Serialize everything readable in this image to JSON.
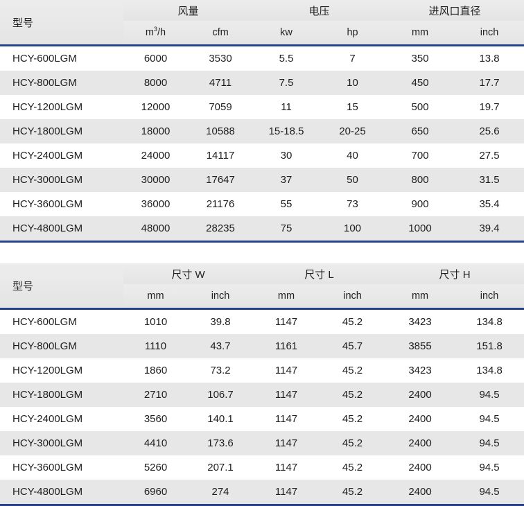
{
  "tables": [
    {
      "id": "performance-table",
      "model_header": "型号",
      "groups": [
        {
          "label": "风量",
          "units": [
            "m³/h",
            "cfm"
          ]
        },
        {
          "label": "电压",
          "units": [
            "kw",
            "hp"
          ]
        },
        {
          "label": "进风口直径",
          "units": [
            "mm",
            "inch"
          ]
        }
      ],
      "rows": [
        {
          "model": "HCY-600LGM",
          "cells": [
            "6000",
            "3530",
            "5.5",
            "7",
            "350",
            "13.8"
          ]
        },
        {
          "model": "HCY-800LGM",
          "cells": [
            "8000",
            "4711",
            "7.5",
            "10",
            "450",
            "17.7"
          ]
        },
        {
          "model": "HCY-1200LGM",
          "cells": [
            "12000",
            "7059",
            "11",
            "15",
            "500",
            "19.7"
          ]
        },
        {
          "model": "HCY-1800LGM",
          "cells": [
            "18000",
            "10588",
            "15-18.5",
            "20-25",
            "650",
            "25.6"
          ]
        },
        {
          "model": "HCY-2400LGM",
          "cells": [
            "24000",
            "14117",
            "30",
            "40",
            "700",
            "27.5"
          ]
        },
        {
          "model": "HCY-3000LGM",
          "cells": [
            "30000",
            "17647",
            "37",
            "50",
            "800",
            "31.5"
          ]
        },
        {
          "model": "HCY-3600LGM",
          "cells": [
            "36000",
            "21176",
            "55",
            "73",
            "900",
            "35.4"
          ]
        },
        {
          "model": "HCY-4800LGM",
          "cells": [
            "48000",
            "28235",
            "75",
            "100",
            "1000",
            "39.4"
          ]
        }
      ]
    },
    {
      "id": "dimensions-table",
      "model_header": "型号",
      "groups": [
        {
          "label": "尺寸 W",
          "units": [
            "mm",
            "inch"
          ]
        },
        {
          "label": "尺寸 L",
          "units": [
            "mm",
            "inch"
          ]
        },
        {
          "label": "尺寸 H",
          "units": [
            "mm",
            "inch"
          ]
        }
      ],
      "rows": [
        {
          "model": "HCY-600LGM",
          "cells": [
            "1010",
            "39.8",
            "1147",
            "45.2",
            "3423",
            "134.8"
          ]
        },
        {
          "model": "HCY-800LGM",
          "cells": [
            "1110",
            "43.7",
            "1161",
            "45.7",
            "3855",
            "151.8"
          ]
        },
        {
          "model": "HCY-1200LGM",
          "cells": [
            "1860",
            "73.2",
            "1147",
            "45.2",
            "3423",
            "134.8"
          ]
        },
        {
          "model": "HCY-1800LGM",
          "cells": [
            "2710",
            "106.7",
            "1147",
            "45.2",
            "2400",
            "94.5"
          ]
        },
        {
          "model": "HCY-2400LGM",
          "cells": [
            "3560",
            "140.1",
            "1147",
            "45.2",
            "2400",
            "94.5"
          ]
        },
        {
          "model": "HCY-3000LGM",
          "cells": [
            "4410",
            "173.6",
            "1147",
            "45.2",
            "2400",
            "94.5"
          ]
        },
        {
          "model": "HCY-3600LGM",
          "cells": [
            "5260",
            "207.1",
            "1147",
            "45.2",
            "2400",
            "94.5"
          ]
        },
        {
          "model": "HCY-4800LGM",
          "cells": [
            "6960",
            "274",
            "1147",
            "45.2",
            "2400",
            "94.5"
          ]
        }
      ]
    }
  ],
  "colors": {
    "accent_rule": "#26428b",
    "header_bg": "#e9e9e9",
    "stripe_bg": "#e7e7e7",
    "row_bg": "#ffffff"
  }
}
